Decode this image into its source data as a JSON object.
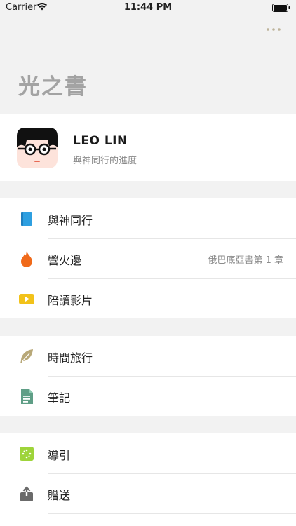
{
  "status_bar": {
    "carrier": "Carrier",
    "time": "11:44 PM"
  },
  "header": {
    "title": "光之書",
    "more_icon": "ellipsis-icon"
  },
  "profile": {
    "name": "LEO LIN",
    "subtitle": "與神同行的進度"
  },
  "groups": [
    {
      "items": [
        {
          "label": "與神同行",
          "icon": "book-icon",
          "color": "#2e9fe0"
        },
        {
          "label": "營火邊",
          "icon": "flame-icon",
          "color": "#f06a1a",
          "detail": "俄巴底亞書第 1 章"
        },
        {
          "label": "陪讀影片",
          "icon": "play-icon",
          "color": "#f2c21a"
        }
      ]
    },
    {
      "items": [
        {
          "label": "時間旅行",
          "icon": "feather-icon",
          "color": "#b8a878"
        },
        {
          "label": "筆記",
          "icon": "note-icon",
          "color": "#5f9e86"
        }
      ]
    },
    {
      "items": [
        {
          "label": "導引",
          "icon": "guide-icon",
          "color": "#9ed43a"
        },
        {
          "label": "贈送",
          "icon": "share-icon",
          "color": "#6a6a6a"
        }
      ]
    }
  ]
}
